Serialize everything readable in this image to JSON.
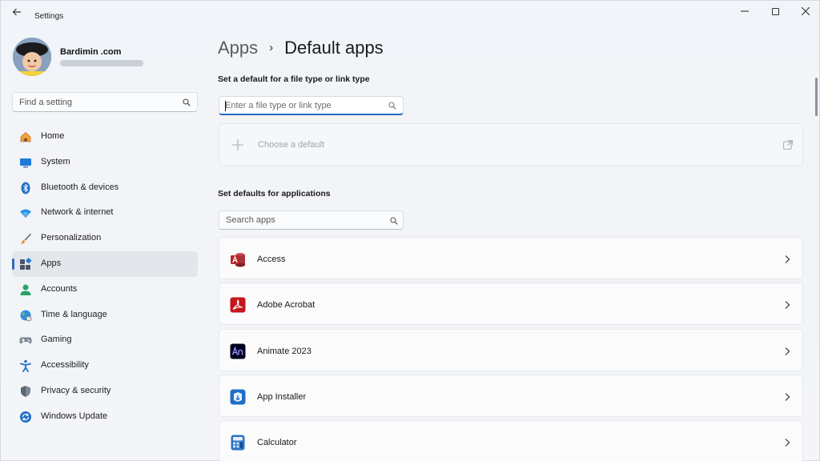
{
  "window": {
    "title": "Settings",
    "back_icon": "back-arrow-icon",
    "controls": [
      "minimize-icon",
      "maximize-icon",
      "close-icon"
    ]
  },
  "profile": {
    "name": "Bardimin .com"
  },
  "sidebar": {
    "search_placeholder": "Find a setting",
    "items": [
      {
        "label": "Home",
        "icon": "home-icon",
        "selected": false
      },
      {
        "label": "System",
        "icon": "system-icon",
        "selected": false
      },
      {
        "label": "Bluetooth & devices",
        "icon": "bluetooth-icon",
        "selected": false
      },
      {
        "label": "Network & internet",
        "icon": "network-icon",
        "selected": false
      },
      {
        "label": "Personalization",
        "icon": "brush-icon",
        "selected": false
      },
      {
        "label": "Apps",
        "icon": "apps-icon",
        "selected": true
      },
      {
        "label": "Accounts",
        "icon": "accounts-icon",
        "selected": false
      },
      {
        "label": "Time & language",
        "icon": "globe-icon",
        "selected": false
      },
      {
        "label": "Gaming",
        "icon": "gamepad-icon",
        "selected": false
      },
      {
        "label": "Accessibility",
        "icon": "accessibility-icon",
        "selected": false
      },
      {
        "label": "Privacy & security",
        "icon": "shield-icon",
        "selected": false
      },
      {
        "label": "Windows Update",
        "icon": "update-icon",
        "selected": false
      }
    ]
  },
  "main": {
    "breadcrumb": {
      "parent": "Apps",
      "separator": "›",
      "current": "Default apps"
    },
    "file_type_section": {
      "title": "Set a default for a file type or link type",
      "input_placeholder": "Enter a file type or link type",
      "choose_label": "Choose a default"
    },
    "apps_section": {
      "title": "Set defaults for applications",
      "search_placeholder": "Search apps",
      "apps": [
        {
          "name": "Access",
          "icon": "access-icon"
        },
        {
          "name": "Adobe Acrobat",
          "icon": "acrobat-icon"
        },
        {
          "name": "Animate 2023",
          "icon": "animate-icon"
        },
        {
          "name": "App Installer",
          "icon": "app-installer-icon"
        },
        {
          "name": "Calculator",
          "icon": "calculator-icon"
        }
      ]
    }
  },
  "colors": {
    "accent": "#2566c4",
    "access_red": "#a4373a",
    "acrobat_red": "#c4161c",
    "animate_bg": "#01001f",
    "installer_blue": "#1f6fc5"
  }
}
